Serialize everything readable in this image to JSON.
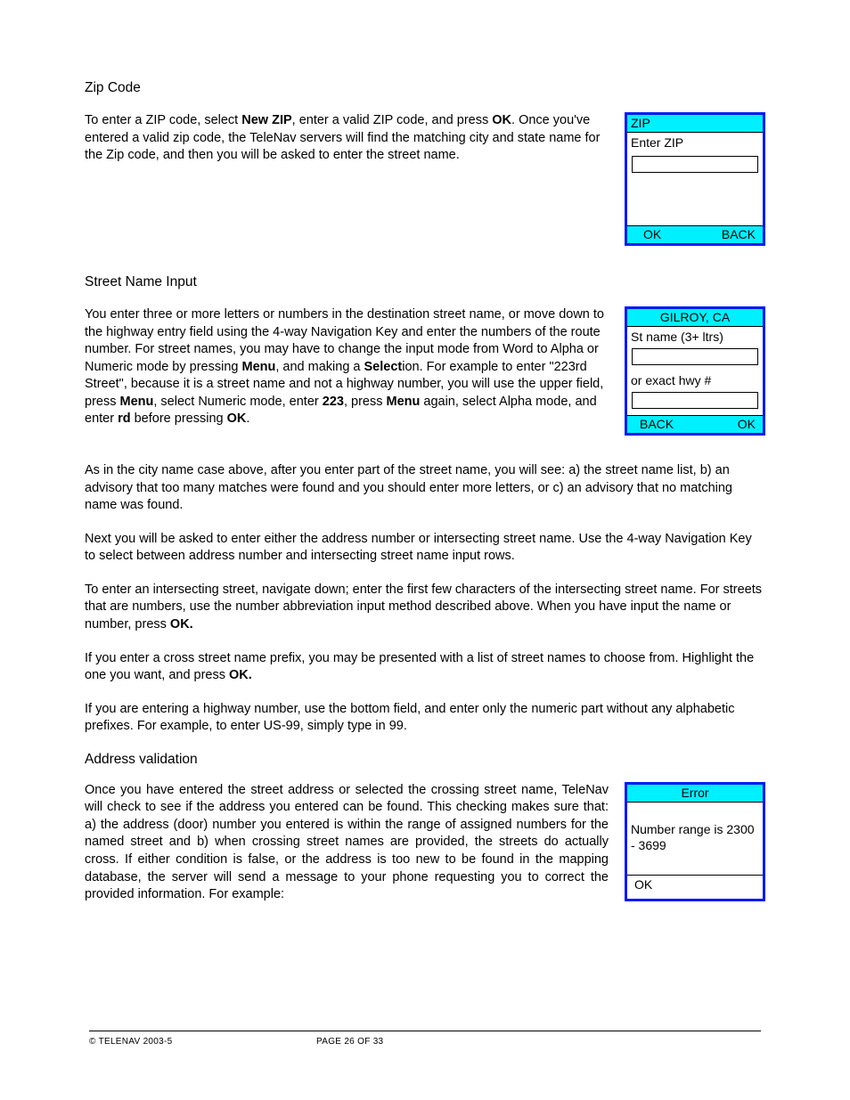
{
  "headings": {
    "zip": "Zip Code",
    "street": "Street Name Input",
    "addr": "Address validation"
  },
  "p_zip": {
    "t1": "To enter a ZIP code, select ",
    "b1": "New ZIP",
    "t2": ", enter a valid ZIP code, and press ",
    "b2": "OK",
    "t3": ". Once you've entered a valid zip code, the TeleNav servers will find the matching city and state name for the Zip code, and then you will be asked to enter the street name."
  },
  "p_street": {
    "t1": "You enter three or more letters or numbers in the destination street name, or move down to the highway entry field using the 4-way Navigation Key and enter the numbers of the route number.  For street names, you may have to change the input mode from Word to Alpha or Numeric mode by pressing ",
    "b1": "Menu",
    "t2": ", and making a ",
    "b2": "Select",
    "t3": "ion.   For example to enter \"223rd Street\", because it is a street name and not a highway number, you will use the upper field, press ",
    "b3": "Menu",
    "t4": ", select Numeric mode, enter ",
    "b4": "223",
    "t5": ", press ",
    "b5": "Menu",
    "t6": " again, select Alpha mode, and enter ",
    "b6": "rd",
    "t7": " before pressing ",
    "b7": "OK",
    "t8": "."
  },
  "p_after1": "As in the city name case above, after you enter part of the street name, you will see: a) the street name list, b) an advisory that too many matches were found and you should enter more letters, or c) an advisory that no matching name was found.",
  "p_after2": "Next you will be asked to enter either the address number or intersecting street name. Use the 4-way Navigation Key to select between address number and intersecting street name input rows.",
  "p_after3": {
    "t1": "To enter an intersecting street, navigate down; enter the first few characters of the intersecting street name.  For streets that are numbers, use the number abbreviation input method described above.   When you have input the name or number, press ",
    "b1": "OK."
  },
  "p_after4": {
    "t1": "If you enter a cross street name prefix, you may be presented with a list of street names to choose from.   Highlight the one you want, and press ",
    "b1": "OK."
  },
  "p_after5": "If you are entering a highway number, use the bottom field, and enter only the numeric part without any alphabetic prefixes.  For example, to enter US-99, simply type in 99.",
  "p_addr": "Once you have entered the street address or selected the crossing street name, TeleNav will check to see if the address you entered can be found.  This checking makes sure that: a) the address (door) number you entered is within the range of assigned numbers for the named street and b) when crossing street names are provided, the streets do actually cross.  If either condition is false, or the address is too new to be found in the mapping database, the server will send a message to your phone requesting you to correct the provided information.   For example:",
  "phone1": {
    "title": "ZIP",
    "label": "Enter ZIP",
    "ok": "OK",
    "back": "BACK"
  },
  "phone2": {
    "title": "GILROY, CA",
    "label1": "St name (3+ ltrs)",
    "label2": "or exact hwy #",
    "back": "BACK",
    "ok": "OK"
  },
  "phone3": {
    "title": "Error",
    "body": "Number range is 2300 - 3699",
    "ok": "OK"
  },
  "footer": {
    "copyright": "© TELENAV 2003-5",
    "page": "PAGE 26 OF 33"
  }
}
